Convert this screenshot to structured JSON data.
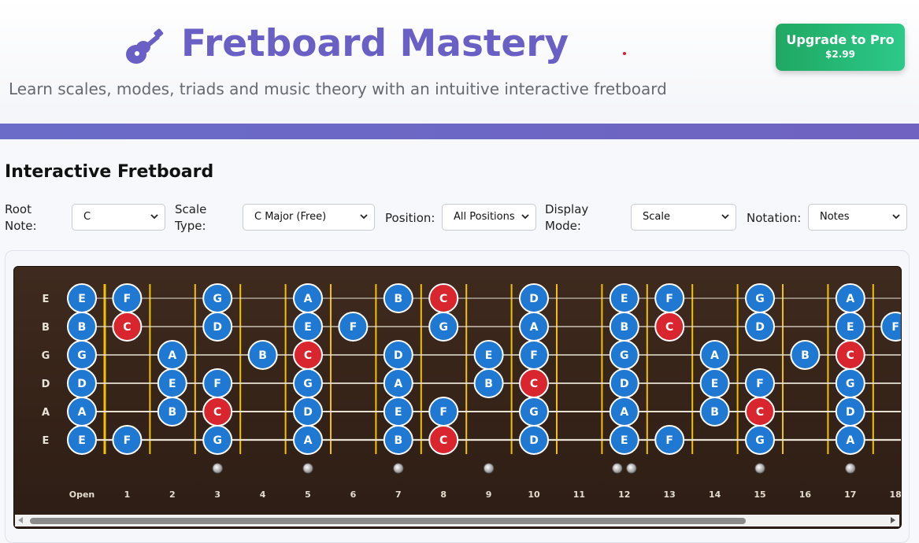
{
  "header": {
    "title": "Fretboard Mastery",
    "subtitle": "Learn scales, modes, triads and music theory with an intuitive interactive fretboard",
    "logo_icon": "guitar-icon",
    "upgrade_label": "Upgrade to Pro",
    "upgrade_price": "$2.99"
  },
  "colors": {
    "title": "#6a5fc4",
    "upgrade": "#1fa862",
    "band": "#6a6cc8",
    "note": "#1f78d1",
    "root_note": "#d9262e",
    "fret_line": "#f2c200"
  },
  "section": {
    "title": "Interactive Fretboard"
  },
  "controls": {
    "root_note": {
      "label": "Root Note:",
      "value": "C"
    },
    "scale_type": {
      "label": "Scale Type:",
      "value": "C Major (Free)"
    },
    "position": {
      "label": "Position:",
      "value": "All Positions"
    },
    "display_mode": {
      "label": "Display Mode:",
      "value": "Scale"
    },
    "notation": {
      "label": "Notation:",
      "value": "Notes"
    }
  },
  "fretboard": {
    "root": "C",
    "strings": [
      "E",
      "B",
      "G",
      "D",
      "A",
      "E"
    ],
    "fret_labels": [
      "Open",
      "1",
      "2",
      "3",
      "4",
      "5",
      "6",
      "7",
      "8",
      "9",
      "10",
      "11",
      "12",
      "13",
      "14",
      "15",
      "16",
      "17",
      "18"
    ],
    "inlay_frets": [
      3,
      5,
      7,
      9,
      12,
      15,
      17
    ],
    "notes": [
      [
        [
          0,
          "E"
        ],
        [
          1,
          "F"
        ],
        [
          3,
          "G"
        ],
        [
          5,
          "A"
        ],
        [
          7,
          "B"
        ],
        [
          8,
          "C"
        ],
        [
          10,
          "D"
        ],
        [
          12,
          "E"
        ],
        [
          13,
          "F"
        ],
        [
          15,
          "G"
        ],
        [
          17,
          "A"
        ]
      ],
      [
        [
          0,
          "B"
        ],
        [
          1,
          "C"
        ],
        [
          3,
          "D"
        ],
        [
          5,
          "E"
        ],
        [
          6,
          "F"
        ],
        [
          8,
          "G"
        ],
        [
          10,
          "A"
        ],
        [
          12,
          "B"
        ],
        [
          13,
          "C"
        ],
        [
          15,
          "D"
        ],
        [
          17,
          "E"
        ],
        [
          18,
          "F"
        ]
      ],
      [
        [
          0,
          "G"
        ],
        [
          2,
          "A"
        ],
        [
          4,
          "B"
        ],
        [
          5,
          "C"
        ],
        [
          7,
          "D"
        ],
        [
          9,
          "E"
        ],
        [
          10,
          "F"
        ],
        [
          12,
          "G"
        ],
        [
          14,
          "A"
        ],
        [
          16,
          "B"
        ],
        [
          17,
          "C"
        ]
      ],
      [
        [
          0,
          "D"
        ],
        [
          2,
          "E"
        ],
        [
          3,
          "F"
        ],
        [
          5,
          "G"
        ],
        [
          7,
          "A"
        ],
        [
          9,
          "B"
        ],
        [
          10,
          "C"
        ],
        [
          12,
          "D"
        ],
        [
          14,
          "E"
        ],
        [
          15,
          "F"
        ],
        [
          17,
          "G"
        ]
      ],
      [
        [
          0,
          "A"
        ],
        [
          2,
          "B"
        ],
        [
          3,
          "C"
        ],
        [
          5,
          "D"
        ],
        [
          7,
          "E"
        ],
        [
          8,
          "F"
        ],
        [
          10,
          "G"
        ],
        [
          12,
          "A"
        ],
        [
          14,
          "B"
        ],
        [
          15,
          "C"
        ],
        [
          17,
          "D"
        ]
      ],
      [
        [
          0,
          "E"
        ],
        [
          1,
          "F"
        ],
        [
          3,
          "G"
        ],
        [
          5,
          "A"
        ],
        [
          7,
          "B"
        ],
        [
          8,
          "C"
        ],
        [
          10,
          "D"
        ],
        [
          12,
          "E"
        ],
        [
          13,
          "F"
        ],
        [
          15,
          "G"
        ],
        [
          17,
          "A"
        ]
      ]
    ]
  }
}
